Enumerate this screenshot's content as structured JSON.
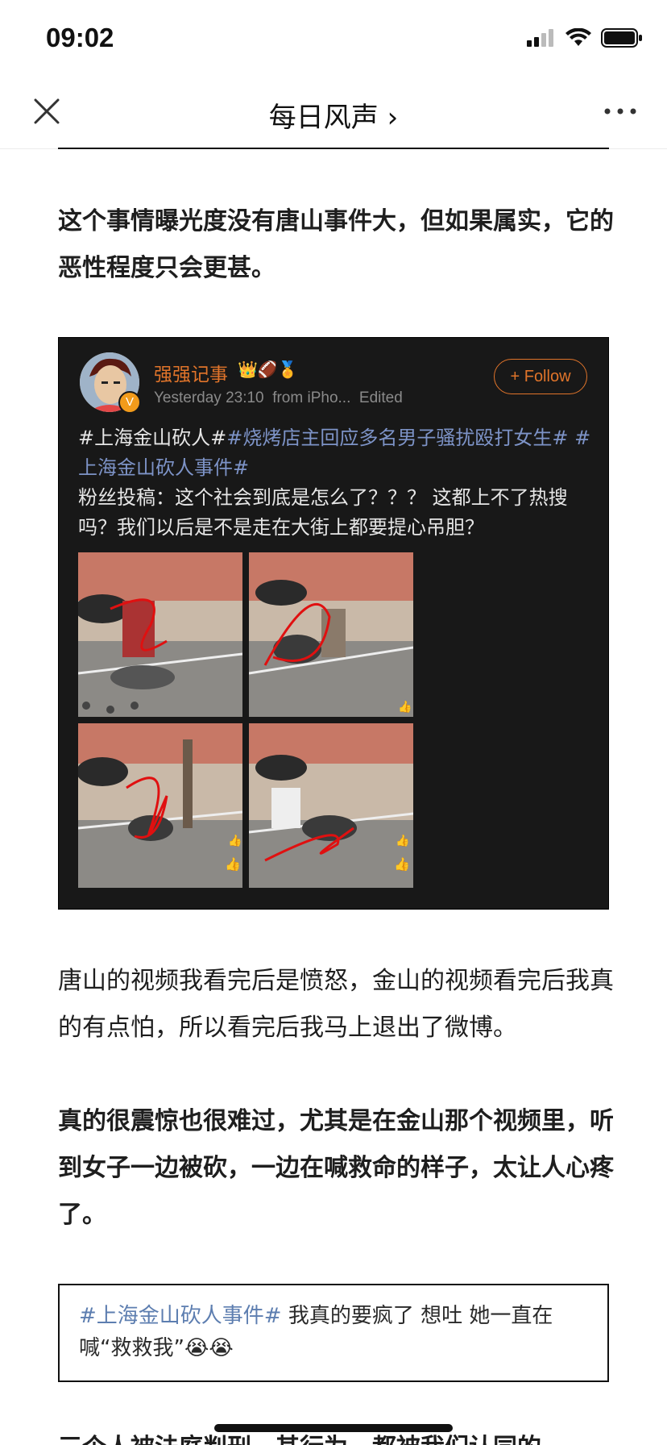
{
  "status": {
    "time": "09:02"
  },
  "nav": {
    "title": "每日风声 ›"
  },
  "article": {
    "para1": "这个事情曝光度没有唐山事件大，但如果属实，它的恶性程度只会更甚。",
    "para2": "唐山的视频我看完后是愤怒，金山的视频看完后我真的有点怕，所以看完后我马上退出了微博。",
    "para3": "真的很震惊也很难过，尤其是在金山那个视频里，听到女子一边被砍，一边在喊救命的样子，太让人心疼了。",
    "cut_line": "三个人被法庭判刑，其行为，都被我们认同的"
  },
  "embed": {
    "username": "强强记事",
    "badges": "👑🏈🏅",
    "verified_mark": "V",
    "timestamp": "Yesterday 23:10",
    "source": "from iPho...",
    "edited": "Edited",
    "follow_label": "+ Follow",
    "tag1": "#上海金山砍人#",
    "tag2": "#烧烤店主回应多名男子骚扰殴打女生#",
    "tag3": "#上海金山砍人事件#",
    "body": "粉丝投稿：这个社会到底是怎么了？？？ 这都上不了热搜吗？我们以后是不是走在大街上都要提心吊胆？"
  },
  "comment": {
    "tag": "#上海金山砍人事件#",
    "text": " 我真的要疯了 想吐 她一直在喊“救救我”😭😭"
  }
}
